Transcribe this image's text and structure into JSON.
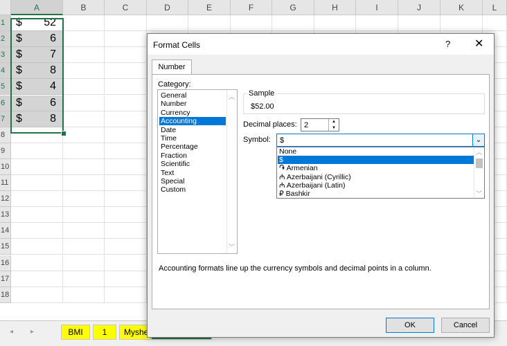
{
  "spreadsheet": {
    "columns": [
      "A",
      "B",
      "C",
      "D",
      "E",
      "F",
      "G",
      "H",
      "I",
      "J",
      "K",
      "L"
    ],
    "rows": [
      "1",
      "2",
      "3",
      "4",
      "5",
      "6",
      "7",
      "8",
      "9",
      "10",
      "11",
      "12",
      "13",
      "14",
      "15",
      "16",
      "17",
      "18"
    ],
    "cells_a": [
      {
        "symbol": "$",
        "value": "52"
      },
      {
        "symbol": "$",
        "value": "6"
      },
      {
        "symbol": "$",
        "value": "7"
      },
      {
        "symbol": "$",
        "value": "8"
      },
      {
        "symbol": "$",
        "value": "4"
      },
      {
        "symbol": "$",
        "value": "6"
      },
      {
        "symbol": "$",
        "value": "8"
      }
    ],
    "sheet_tabs": [
      "BMI",
      "1",
      "Myshe"
    ],
    "nav_prev": "◂",
    "nav_next": "▸",
    "accent_color": "#217346"
  },
  "dialog": {
    "title": "Format Cells",
    "help": "?",
    "close": "✕",
    "tab": "Number",
    "category_label": "Category:",
    "categories": [
      "General",
      "Number",
      "Currency",
      "Accounting",
      "Date",
      "Time",
      "Percentage",
      "Fraction",
      "Scientific",
      "Text",
      "Special",
      "Custom"
    ],
    "selected_category": "Accounting",
    "sample_label": "Sample",
    "sample_value": "$52.00",
    "decimal_label": "Decimal places:",
    "decimal_value": "2",
    "symbol_label": "Symbol:",
    "symbol_value": "$",
    "symbol_options": [
      "None",
      "$",
      "֏ Armenian",
      "₼ Azerbaijani (Cyrillic)",
      "₼ Azerbaijani (Latin)",
      "₽ Bashkir"
    ],
    "selected_symbol": "$",
    "description": "Accounting formats line up the currency symbols and decimal points in a column.",
    "ok": "OK",
    "cancel": "Cancel",
    "selection_color": "#0078d7"
  }
}
